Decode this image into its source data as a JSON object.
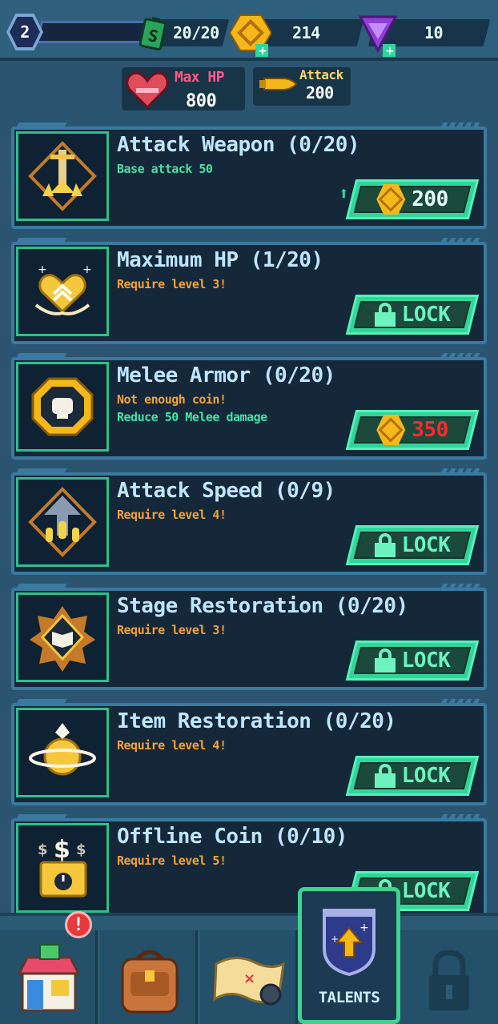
{
  "topbar": {
    "level": "2",
    "energy": "20/20",
    "coins": "214",
    "gems": "10"
  },
  "stats": {
    "hp_label": "Max HP",
    "hp_value": "800",
    "attack_label": "Attack",
    "attack_value": "200"
  },
  "talents": [
    {
      "title": "Attack Weapon (0/20)",
      "subtitle": [
        "Base attack 50"
      ],
      "subtitle_color": "green",
      "button": "200",
      "button_type": "coin"
    },
    {
      "title": "Maximum HP (1/20)",
      "subtitle": [
        "Require level 3!"
      ],
      "subtitle_color": "orange",
      "button": "LOCK",
      "button_type": "lock"
    },
    {
      "title": "Melee Armor (0/20)",
      "subtitle": [
        "Not enough coin!",
        "Reduce 50 Melee damage"
      ],
      "subtitle_color": "mixed",
      "button": "350",
      "button_type": "coin-insufficient"
    },
    {
      "title": "Attack Speed (0/9)",
      "subtitle": [
        "Require level 4!"
      ],
      "subtitle_color": "orange",
      "button": "LOCK",
      "button_type": "lock"
    },
    {
      "title": "Stage Restoration (0/20)",
      "subtitle": [
        "Require level 3!"
      ],
      "subtitle_color": "orange",
      "button": "LOCK",
      "button_type": "lock"
    },
    {
      "title": "Item Restoration (0/20)",
      "subtitle": [
        "Require level 4!"
      ],
      "subtitle_color": "orange",
      "button": "LOCK",
      "button_type": "lock"
    },
    {
      "title": "Offline Coin (0/10)",
      "subtitle": [
        "Require level 5!"
      ],
      "subtitle_color": "orange",
      "button": "LOCK",
      "button_type": "lock"
    }
  ],
  "nav": {
    "badge": "!",
    "active_label": "TALENTS"
  },
  "colors": {
    "accent_green": "#2fd59a",
    "coin_gold": "#f4b81a",
    "warning_red": "#e5393e",
    "label_pink": "#ff5a8a"
  }
}
